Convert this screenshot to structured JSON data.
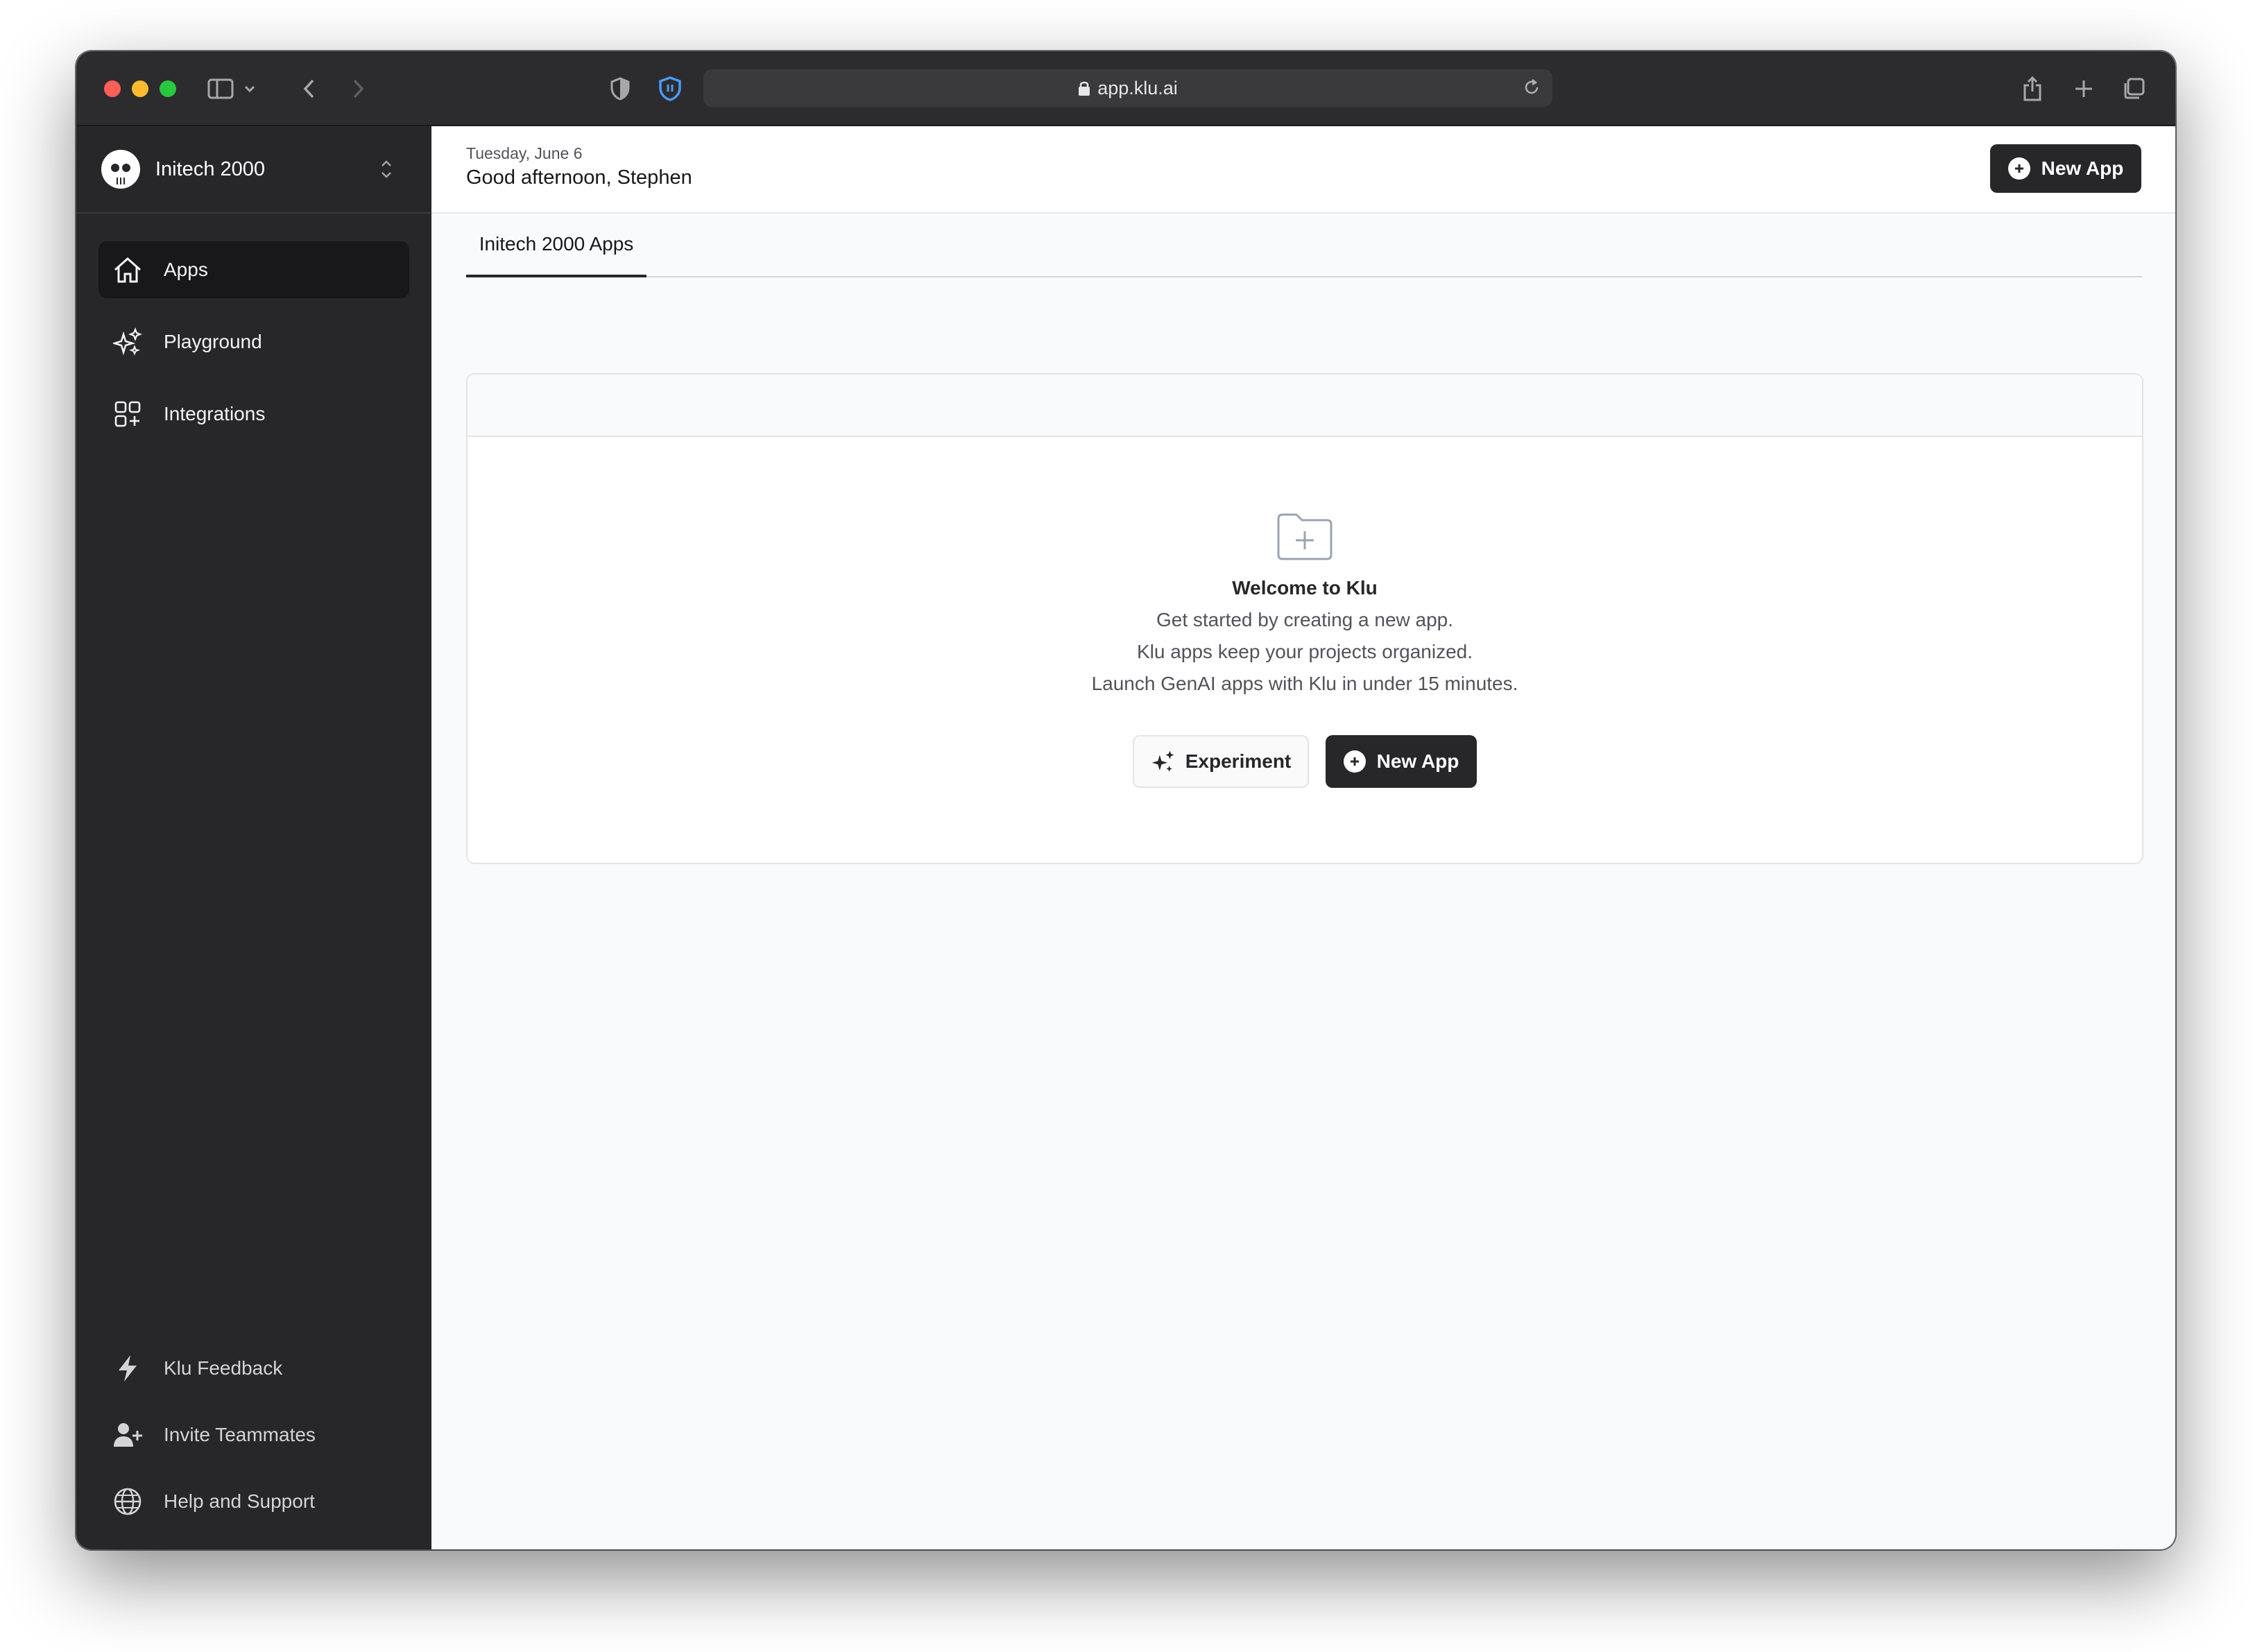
{
  "browser": {
    "url": "app.klu.ai"
  },
  "sidebar": {
    "workspace_name": "Initech 2000",
    "items": [
      {
        "label": "Apps",
        "icon": "home-icon",
        "active": true
      },
      {
        "label": "Playground",
        "icon": "sparkles-icon"
      },
      {
        "label": "Integrations",
        "icon": "squares-plus-icon"
      }
    ],
    "bottom_items": [
      {
        "label": "Klu Feedback",
        "icon": "bolt-icon"
      },
      {
        "label": "Invite Teammates",
        "icon": "user-plus-icon"
      },
      {
        "label": "Help and Support",
        "icon": "globe-icon"
      }
    ]
  },
  "header": {
    "date": "Tuesday, June 6",
    "greeting": "Good afternoon, Stephen",
    "new_app_label": "New App"
  },
  "tabs": [
    {
      "label": "Initech 2000 Apps",
      "active": true
    }
  ],
  "empty_state": {
    "icon": "folder-plus-icon",
    "title": "Welcome to Klu",
    "lines": [
      "Get started by creating a new app.",
      "Klu apps keep your projects organized.",
      "Launch GenAI apps with Klu in under 15 minutes."
    ],
    "experiment_label": "Experiment",
    "new_app_label": "New App"
  },
  "colors": {
    "sidebar_bg": "#27272a",
    "active_nav_bg": "#18181b",
    "primary_button": "#27272a",
    "main_bg": "#f9fafb"
  }
}
